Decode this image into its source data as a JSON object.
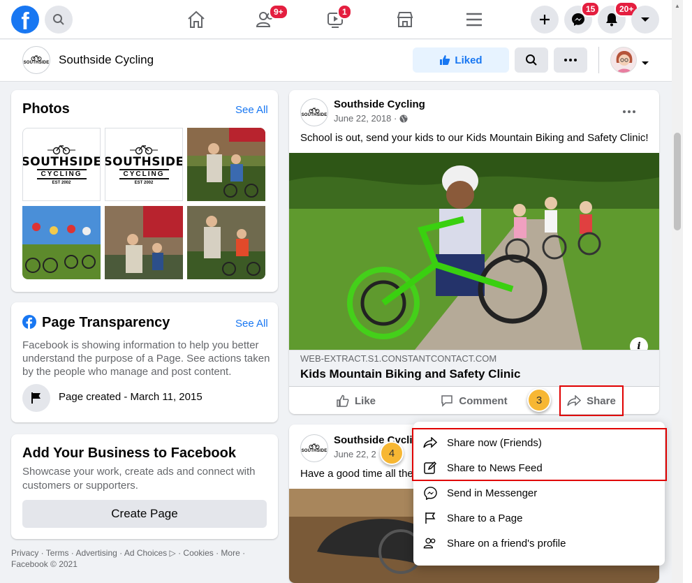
{
  "topnav": {
    "logo_letter": "f",
    "friends_badge": "9+",
    "watch_badge": "1",
    "messenger_badge": "15",
    "notifications_badge": "20+"
  },
  "page_header": {
    "page_name": "Southside Cycling",
    "liked_label": "Liked"
  },
  "logo": {
    "brand": "SOUTHSIDE",
    "sub": "CYCLING",
    "est": "EST 2002"
  },
  "photos_card": {
    "title": "Photos",
    "see_all": "See All"
  },
  "transparency_card": {
    "title": "Page Transparency",
    "see_all": "See All",
    "description": "Facebook is showing information to help you better understand the purpose of a Page. See actions taken by the people who manage and post content.",
    "page_created": "Page created - March 11, 2015"
  },
  "business_card": {
    "title": "Add Your Business to Facebook",
    "description": "Showcase your work, create ads and connect with customers or supporters.",
    "button": "Create Page"
  },
  "footer": {
    "links": "Privacy · Terms · Advertising · Ad Choices ▷ · Cookies · More ·",
    "copyright": "Facebook © 2021"
  },
  "post1": {
    "author": "Southside Cycling",
    "date": "June 22, 2018 ·",
    "text": "School is out, send your kids to our Kids Mountain Biking and Safety Clinic!",
    "link_domain": "WEB-EXTRACT.S1.CONSTANTCONTACT.COM",
    "link_title": "Kids Mountain Biking and Safety Clinic",
    "like": "Like",
    "comment": "Comment",
    "share": "Share"
  },
  "post2": {
    "author": "Southside Cycling",
    "date": "June 22, 2",
    "text": "Have a good time all the"
  },
  "callouts": {
    "step3": "3",
    "step4": "4"
  },
  "share_menu": {
    "items": [
      "Share now (Friends)",
      "Share to News Feed",
      "Send in Messenger",
      "Share to a Page",
      "Share on a friend's profile"
    ]
  },
  "colors": {
    "brand_blue": "#1877f2",
    "badge_red": "#e41e3f",
    "callout_orange": "#f7b733",
    "highlight_red": "#e00000"
  }
}
